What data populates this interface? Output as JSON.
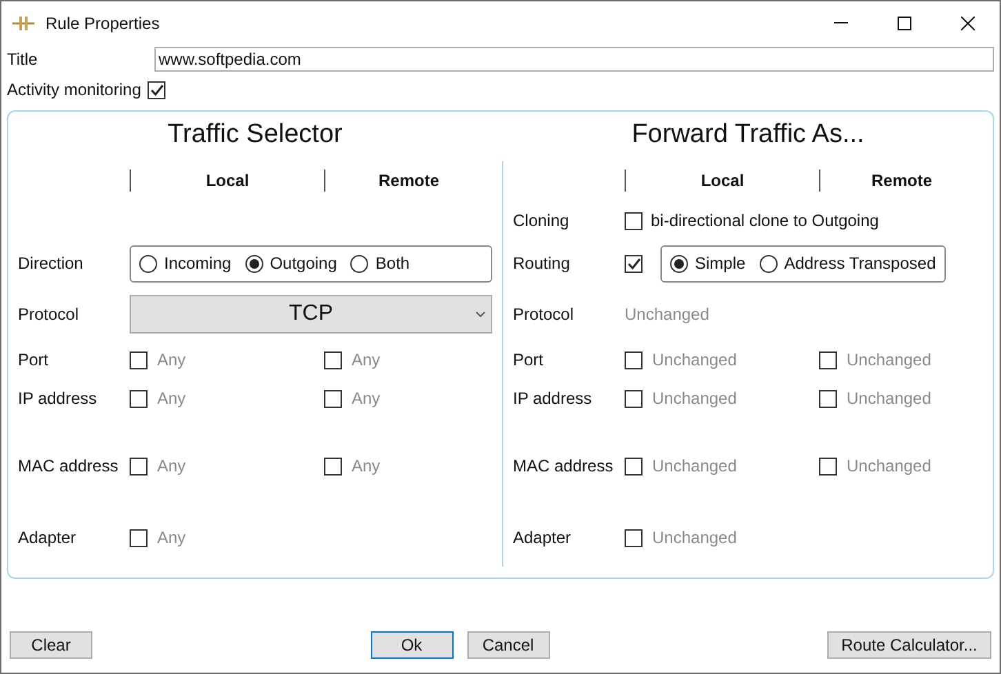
{
  "window": {
    "title": "Rule Properties"
  },
  "title_field": {
    "label": "Title",
    "value": "www.softpedia.com"
  },
  "activity_monitoring": {
    "label": "Activity monitoring",
    "checked": true
  },
  "traffic_selector": {
    "heading": "Traffic Selector",
    "columns": [
      "Local",
      "Remote"
    ],
    "direction": {
      "label": "Direction",
      "options": [
        {
          "label": "Incoming",
          "selected": false
        },
        {
          "label": "Outgoing",
          "selected": true
        },
        {
          "label": "Both",
          "selected": false
        }
      ]
    },
    "protocol": {
      "label": "Protocol",
      "value": "TCP"
    },
    "rows": [
      {
        "label": "Port",
        "local": {
          "label": "Any",
          "checked": false
        },
        "remote": {
          "label": "Any",
          "checked": false
        }
      },
      {
        "label": "IP address",
        "local": {
          "label": "Any",
          "checked": false
        },
        "remote": {
          "label": "Any",
          "checked": false
        }
      },
      {
        "label": "MAC address",
        "local": {
          "label": "Any",
          "checked": false
        },
        "remote": {
          "label": "Any",
          "checked": false
        }
      },
      {
        "label": "Adapter",
        "local": {
          "label": "Any",
          "checked": false
        }
      }
    ]
  },
  "forward": {
    "heading": "Forward Traffic As...",
    "columns": [
      "Local",
      "Remote"
    ],
    "cloning": {
      "label": "Cloning",
      "option": "bi-directional clone to Outgoing",
      "checked": false
    },
    "routing": {
      "label": "Routing",
      "checked": true,
      "options": [
        {
          "label": "Simple",
          "selected": true
        },
        {
          "label": "Address Transposed",
          "selected": false
        }
      ]
    },
    "protocol": {
      "label": "Protocol",
      "value": "Unchanged"
    },
    "rows": [
      {
        "label": "Port",
        "local": {
          "label": "Unchanged",
          "checked": false
        },
        "remote": {
          "label": "Unchanged",
          "checked": false
        }
      },
      {
        "label": "IP address",
        "local": {
          "label": "Unchanged",
          "checked": false
        },
        "remote": {
          "label": "Unchanged",
          "checked": false
        }
      },
      {
        "label": "MAC address",
        "local": {
          "label": "Unchanged",
          "checked": false
        },
        "remote": {
          "label": "Unchanged",
          "checked": false
        }
      },
      {
        "label": "Adapter",
        "local": {
          "label": "Unchanged",
          "checked": false
        }
      }
    ]
  },
  "buttons": [
    {
      "label": "Clear",
      "default": false
    },
    {
      "label": "Ok",
      "default": true
    },
    {
      "label": "Cancel",
      "default": false
    },
    {
      "label": "Route Calculator...",
      "default": false
    }
  ]
}
